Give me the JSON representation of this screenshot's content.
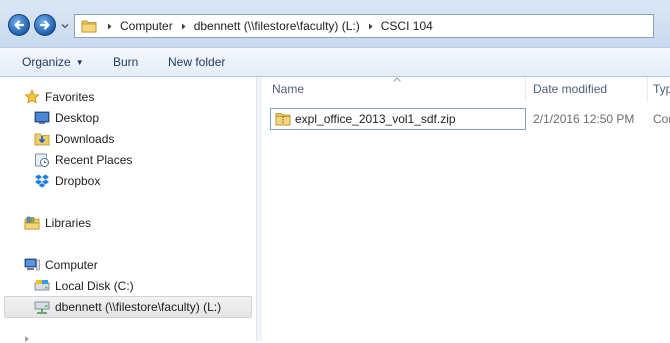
{
  "address_bar": {
    "breadcrumbs": [
      "Computer",
      "dbennett (\\\\filestore\\faculty) (L:)",
      "CSCI 104"
    ]
  },
  "toolbar": {
    "organize_label": "Organize",
    "burn_label": "Burn",
    "new_folder_label": "New folder"
  },
  "nav_pane": {
    "favorites": {
      "label": "Favorites",
      "items": [
        {
          "label": "Desktop",
          "icon": "desktop-icon"
        },
        {
          "label": "Downloads",
          "icon": "downloads-icon"
        },
        {
          "label": "Recent Places",
          "icon": "recent-places-icon"
        },
        {
          "label": "Dropbox",
          "icon": "dropbox-icon"
        }
      ]
    },
    "libraries": {
      "label": "Libraries"
    },
    "computer": {
      "label": "Computer",
      "items": [
        {
          "label": "Local Disk (C:)",
          "icon": "local-disk-icon"
        },
        {
          "label": "dbennett (\\\\filestore\\faculty) (L:)",
          "icon": "network-drive-icon",
          "selected": true
        }
      ]
    }
  },
  "file_list": {
    "columns": [
      "Name",
      "Date modified",
      "Typ"
    ],
    "sorted_by": "Name",
    "rows": [
      {
        "name": "expl_office_2013_vol1_sdf.zip",
        "date_modified": "2/1/2016 12:50 PM",
        "type": "Com",
        "icon": "zip-folder-icon"
      }
    ]
  },
  "colors": {
    "address_bar_bg": "#c9d9ee",
    "selection_border": "#7da2ce",
    "link_text": "#1e3a5f"
  }
}
